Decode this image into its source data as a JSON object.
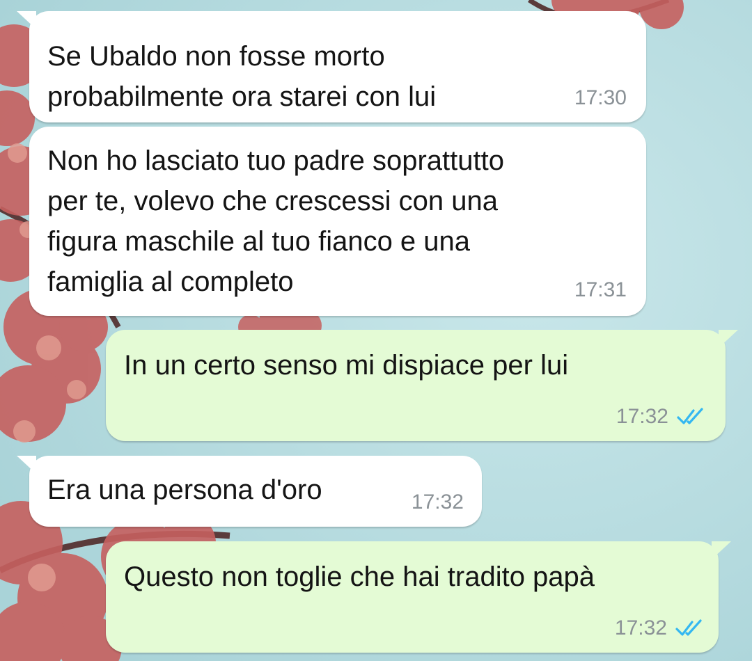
{
  "colors": {
    "incoming_bubble": "#ffffff",
    "outgoing_bubble": "#e4fbd5",
    "read_ticks": "#34b7f1",
    "timestamp": "#8a9196",
    "wallpaper_sky": "#b9dde1",
    "wallpaper_blossom": "#c6605f"
  },
  "messages": [
    {
      "direction": "incoming",
      "text": "Se Ubaldo non fosse morto\nprobabilmente ora starei con lui",
      "time": "17:30"
    },
    {
      "direction": "incoming",
      "text": "Non ho lasciato tuo padre soprattutto\nper te, volevo che crescessi con una\nfigura maschile al tuo fianco e una\nfamiglia al completo",
      "time": "17:31"
    },
    {
      "direction": "outgoing",
      "text": "In un certo senso mi dispiace per lui",
      "time": "17:32",
      "status_icon": "double-check-read-icon"
    },
    {
      "direction": "incoming",
      "text": "Era una persona d'oro",
      "time": "17:32"
    },
    {
      "direction": "outgoing",
      "text": "Questo non toglie che hai tradito papà",
      "time": "17:32",
      "status_icon": "double-check-read-icon"
    }
  ]
}
